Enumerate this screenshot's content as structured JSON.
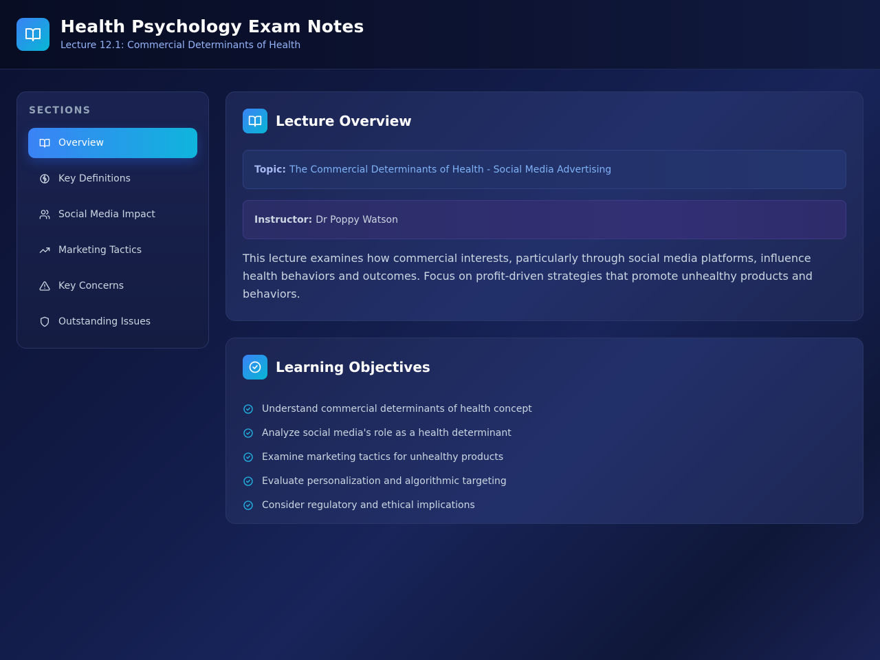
{
  "header": {
    "title": "Health Psychology Exam Notes",
    "subtitle": "Lecture 12.1: Commercial Determinants of Health",
    "logo_icon": "book-open-icon"
  },
  "sidebar": {
    "heading": "SECTIONS",
    "items": [
      {
        "label": "Overview",
        "icon": "book-open-icon",
        "active": true
      },
      {
        "label": "Key Definitions",
        "icon": "brain-icon",
        "active": false
      },
      {
        "label": "Social Media Impact",
        "icon": "users-icon",
        "active": false
      },
      {
        "label": "Marketing Tactics",
        "icon": "trending-up-icon",
        "active": false
      },
      {
        "label": "Key Concerns",
        "icon": "alert-triangle-icon",
        "active": false
      },
      {
        "label": "Outstanding Issues",
        "icon": "shield-icon",
        "active": false
      }
    ]
  },
  "overview": {
    "title": "Lecture Overview",
    "icon": "book-open-icon",
    "topic_label": "Topic:",
    "topic_value": "The Commercial Determinants of Health - Social Media Advertising",
    "instructor_label": "Instructor:",
    "instructor_value": "Dr Poppy Watson",
    "description": "This lecture examines how commercial interests, particularly through social media platforms, influence health behaviors and outcomes. Focus on profit-driven strategies that promote unhealthy products and behaviors."
  },
  "objectives": {
    "title": "Learning Objectives",
    "icon": "check-circle-icon",
    "items": [
      "Understand commercial determinants of health concept",
      "Analyze social media's role as a health determinant",
      "Examine marketing tactics for unhealthy products",
      "Evaluate personalization and algorithmic targeting",
      "Consider regulatory and ethical implications"
    ]
  },
  "colors": {
    "accent_start": "#3b82f6",
    "accent_end": "#06b6d4",
    "background": "#111a44"
  }
}
